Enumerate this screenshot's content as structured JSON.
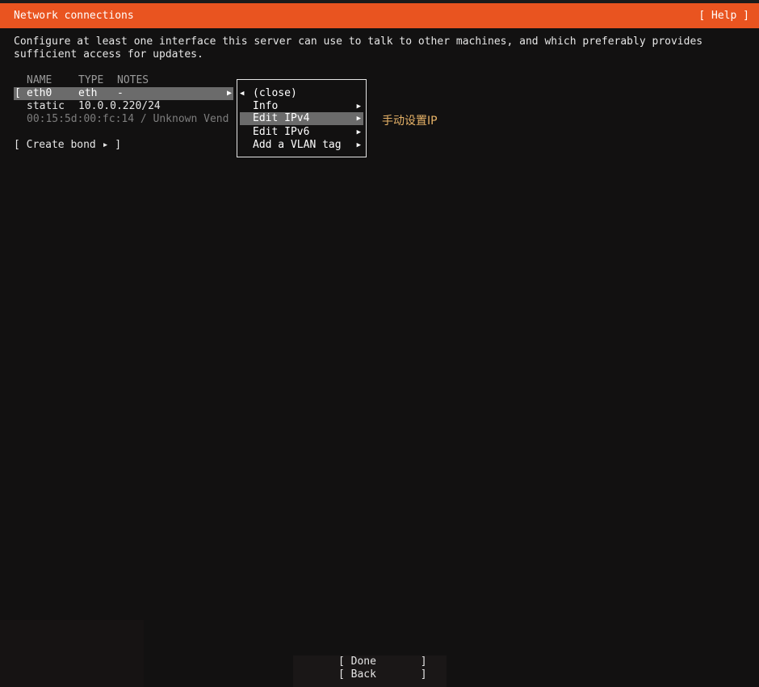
{
  "header": {
    "title": "Network connections",
    "help_label": "[ Help ]",
    "accent_color": "#e95420"
  },
  "description": {
    "line1": "Configure at least one interface this server can use to talk to other machines, and which preferably provides",
    "line2": "sufficient access for updates."
  },
  "table": {
    "columns": [
      "NAME",
      "TYPE",
      "NOTES"
    ],
    "interface": {
      "open_bracket": "[",
      "name": "eth0",
      "type": "eth",
      "notes": "-"
    },
    "address": {
      "mode": "static",
      "ip": "10.0.0.220/24"
    },
    "hardware": "00:15:5d:00:fc:14 / Unknown Vend"
  },
  "create_bond_label": "[ Create bond ▸ ]",
  "menu": {
    "items": [
      {
        "label": "(close)"
      },
      {
        "label": "Info"
      },
      {
        "label": "Edit IPv4"
      },
      {
        "label": "Edit IPv6"
      },
      {
        "label": "Add a VLAN tag"
      }
    ],
    "selected_index": 2
  },
  "annotation": "手动设置IP",
  "footer": {
    "done_label": "[ Done       ]",
    "back_label": "[ Back       ]"
  },
  "icons": {
    "back_arrow": "arrow-left-icon",
    "submenu_arrow": "arrow-right-icon"
  }
}
